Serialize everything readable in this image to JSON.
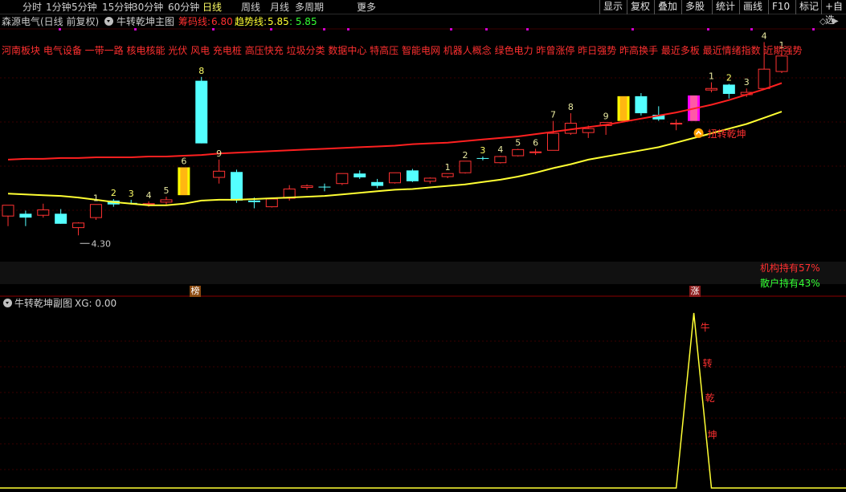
{
  "toolbar": {
    "periods": [
      "分时",
      "1分钟",
      "5分钟",
      "15分钟",
      "30分钟",
      "60分钟",
      "日线",
      "周线",
      "月线",
      "多周期",
      "更多"
    ],
    "active_period": "日线",
    "more_arrow": "›",
    "right_buttons": [
      "显示",
      "复权",
      "叠加",
      "多股",
      "统计",
      "画线",
      "F10",
      "标记",
      "+自选"
    ]
  },
  "main_panel": {
    "stock_title": "森源电气(日线 前复权)",
    "indicator_name": "牛转乾坤主图",
    "chip_label": "筹码线:",
    "chip_value": "6.80",
    "trend_label": "趋势线:",
    "trend_value": "5.85",
    "trend_value2": ": 5.85",
    "concepts": "河南板块 电气设备 一带一路 核电核能 光伏 风电 充电桩 高压快充 垃圾分类 数据中心 特高压 智能电网 机器人概念 绿色电力 昨曾涨停 昨日强势 昨高换手 最近多板 最近情绪指数 近期强势",
    "low_label": "4.30",
    "signal_label": "扭转乾坤",
    "institution_text": "机构持有57%",
    "retail_text": "散户持有43%",
    "badge_left": "榜",
    "badge_right": "涨",
    "diamond_icon": "diamond-icon",
    "collapse_icon": "chevron-down-icon"
  },
  "sub_panel": {
    "indicator_name": "牛转乾坤副图",
    "xg_label": "XG: 0.00",
    "peak_chars": [
      "牛",
      "转",
      "乾",
      "坤"
    ]
  },
  "colors": {
    "up_candle": "#ff3232",
    "down_candle": "#54ffff",
    "ma_red": "#ff2020",
    "trend_yellow": "#ffff33",
    "special_bar_yellow": "#ffff00",
    "special_bar_magenta": "#ff00ff",
    "concept_text": "#ff3030",
    "retail_green": "#33ff33",
    "xg_line": "#ffff33"
  },
  "chart_data": [
    {
      "type": "candlestick",
      "title": "牛转乾坤主图",
      "yrange": [
        3.96,
        6.95
      ],
      "candles": [
        {
          "o": 4.55,
          "h": 4.69,
          "l": 4.42,
          "c": 4.69,
          "n": ""
        },
        {
          "o": 4.58,
          "h": 4.62,
          "l": 4.42,
          "c": 4.53,
          "n": ""
        },
        {
          "o": 4.56,
          "h": 4.71,
          "l": 4.53,
          "c": 4.63,
          "n": ""
        },
        {
          "o": 4.58,
          "h": 4.64,
          "l": 4.45,
          "c": 4.45,
          "n": ""
        },
        {
          "o": 4.4,
          "h": 4.47,
          "l": 4.3,
          "c": 4.46,
          "n": ""
        },
        {
          "o": 4.53,
          "h": 4.7,
          "l": 4.5,
          "c": 4.7,
          "n": "1"
        },
        {
          "o": 4.75,
          "h": 4.77,
          "l": 4.67,
          "c": 4.7,
          "n": "2"
        },
        {
          "o": 4.72,
          "h": 4.76,
          "l": 4.7,
          "c": 4.71,
          "n": "3"
        },
        {
          "o": 4.7,
          "h": 4.74,
          "l": 4.67,
          "c": 4.71,
          "n": "4"
        },
        {
          "o": 4.73,
          "h": 4.8,
          "l": 4.7,
          "c": 4.76,
          "n": "5"
        },
        {
          "o": 4.82,
          "h": 5.18,
          "l": 4.82,
          "c": 5.18,
          "n": "6",
          "s": "yellow"
        },
        {
          "o": 6.3,
          "h": 6.35,
          "l": 5.49,
          "c": 5.49,
          "n": "8"
        },
        {
          "o": 5.05,
          "h": 5.28,
          "l": 4.97,
          "c": 5.13,
          "n": "9"
        },
        {
          "o": 5.12,
          "h": 5.15,
          "l": 4.72,
          "c": 4.75,
          "n": ""
        },
        {
          "o": 4.75,
          "h": 4.79,
          "l": 4.65,
          "c": 4.73,
          "n": ""
        },
        {
          "o": 4.67,
          "h": 4.77,
          "l": 4.66,
          "c": 4.77,
          "n": ""
        },
        {
          "o": 4.78,
          "h": 4.95,
          "l": 4.75,
          "c": 4.9,
          "n": ""
        },
        {
          "o": 4.92,
          "h": 4.96,
          "l": 4.89,
          "c": 4.94,
          "n": ""
        },
        {
          "o": 4.93,
          "h": 4.97,
          "l": 4.87,
          "c": 4.92,
          "n": ""
        },
        {
          "o": 4.97,
          "h": 5.1,
          "l": 4.95,
          "c": 5.1,
          "n": ""
        },
        {
          "o": 5.1,
          "h": 5.14,
          "l": 5.03,
          "c": 5.05,
          "n": ""
        },
        {
          "o": 4.99,
          "h": 5.03,
          "l": 4.91,
          "c": 4.94,
          "n": ""
        },
        {
          "o": 4.98,
          "h": 5.11,
          "l": 4.97,
          "c": 5.11,
          "n": ""
        },
        {
          "o": 5.14,
          "h": 5.16,
          "l": 4.99,
          "c": 5.0,
          "n": ""
        },
        {
          "o": 5.0,
          "h": 5.05,
          "l": 4.97,
          "c": 5.04,
          "n": ""
        },
        {
          "o": 5.06,
          "h": 5.1,
          "l": 5.04,
          "c": 5.1,
          "n": "1"
        },
        {
          "o": 5.11,
          "h": 5.26,
          "l": 5.1,
          "c": 5.26,
          "n": "2"
        },
        {
          "o": 5.3,
          "h": 5.32,
          "l": 5.27,
          "c": 5.29,
          "n": "3"
        },
        {
          "o": 5.24,
          "h": 5.33,
          "l": 5.23,
          "c": 5.32,
          "n": "4"
        },
        {
          "o": 5.33,
          "h": 5.42,
          "l": 5.32,
          "c": 5.41,
          "n": "5"
        },
        {
          "o": 5.38,
          "h": 5.42,
          "l": 5.34,
          "c": 5.38,
          "n": "6"
        },
        {
          "o": 5.4,
          "h": 5.78,
          "l": 5.4,
          "c": 5.62,
          "n": "7"
        },
        {
          "o": 5.62,
          "h": 5.88,
          "l": 5.6,
          "c": 5.75,
          "n": "8"
        },
        {
          "o": 5.63,
          "h": 5.72,
          "l": 5.56,
          "c": 5.68,
          "n": ""
        },
        {
          "o": 5.72,
          "h": 5.76,
          "l": 5.6,
          "c": 5.76,
          "n": "9"
        },
        {
          "o": 5.78,
          "h": 6.1,
          "l": 5.78,
          "c": 6.1,
          "n": "",
          "s": "yellow"
        },
        {
          "o": 6.1,
          "h": 6.14,
          "l": 5.85,
          "c": 5.88,
          "n": ""
        },
        {
          "o": 5.86,
          "h": 5.97,
          "l": 5.78,
          "c": 5.8,
          "n": ""
        },
        {
          "o": 5.75,
          "h": 5.8,
          "l": 5.66,
          "c": 5.75,
          "n": ""
        },
        {
          "o": 5.78,
          "h": 6.11,
          "l": 5.78,
          "c": 6.11,
          "n": "",
          "s": "magenta"
        },
        {
          "o": 6.18,
          "h": 6.28,
          "l": 6.15,
          "c": 6.2,
          "n": "1"
        },
        {
          "o": 6.25,
          "h": 6.26,
          "l": 6.07,
          "c": 6.13,
          "n": "2"
        },
        {
          "o": 6.12,
          "h": 6.2,
          "l": 6.09,
          "c": 6.15,
          "n": "3"
        },
        {
          "o": 6.2,
          "h": 6.8,
          "l": 6.19,
          "c": 6.45,
          "n": "4"
        },
        {
          "o": 6.42,
          "h": 6.68,
          "l": 6.4,
          "c": 6.62,
          "n": "1"
        }
      ],
      "ma_red": [
        5.28,
        5.29,
        5.29,
        5.3,
        5.3,
        5.31,
        5.31,
        5.31,
        5.32,
        5.32,
        5.33,
        5.34,
        5.36,
        5.37,
        5.38,
        5.39,
        5.4,
        5.41,
        5.42,
        5.43,
        5.44,
        5.45,
        5.46,
        5.48,
        5.49,
        5.5,
        5.52,
        5.54,
        5.56,
        5.58,
        5.61,
        5.64,
        5.67,
        5.7,
        5.73,
        5.77,
        5.81,
        5.85,
        5.89,
        5.94,
        5.99,
        6.05,
        6.12,
        6.19,
        6.27
      ],
      "trend_yellow": [
        4.84,
        4.83,
        4.82,
        4.81,
        4.79,
        4.76,
        4.73,
        4.71,
        4.69,
        4.69,
        4.71,
        4.75,
        4.76,
        4.76,
        4.77,
        4.78,
        4.79,
        4.8,
        4.81,
        4.83,
        4.85,
        4.87,
        4.89,
        4.9,
        4.92,
        4.94,
        4.96,
        4.99,
        5.02,
        5.06,
        5.11,
        5.17,
        5.22,
        5.28,
        5.32,
        5.36,
        5.4,
        5.44,
        5.5,
        5.56,
        5.62,
        5.68,
        5.74,
        5.82,
        5.9
      ]
    },
    {
      "type": "line",
      "title": "牛转乾坤副图",
      "yrange": [
        0,
        1
      ],
      "xg_values": [
        0,
        0,
        0,
        0,
        0,
        0,
        0,
        0,
        0,
        0,
        0,
        0,
        0,
        0,
        0,
        0,
        0,
        0,
        0,
        0,
        0,
        0,
        0,
        0,
        0,
        0,
        0,
        0,
        0,
        0,
        0,
        0,
        0,
        0,
        0,
        0,
        0,
        0,
        0,
        1,
        0,
        0,
        0,
        0,
        0
      ]
    }
  ]
}
